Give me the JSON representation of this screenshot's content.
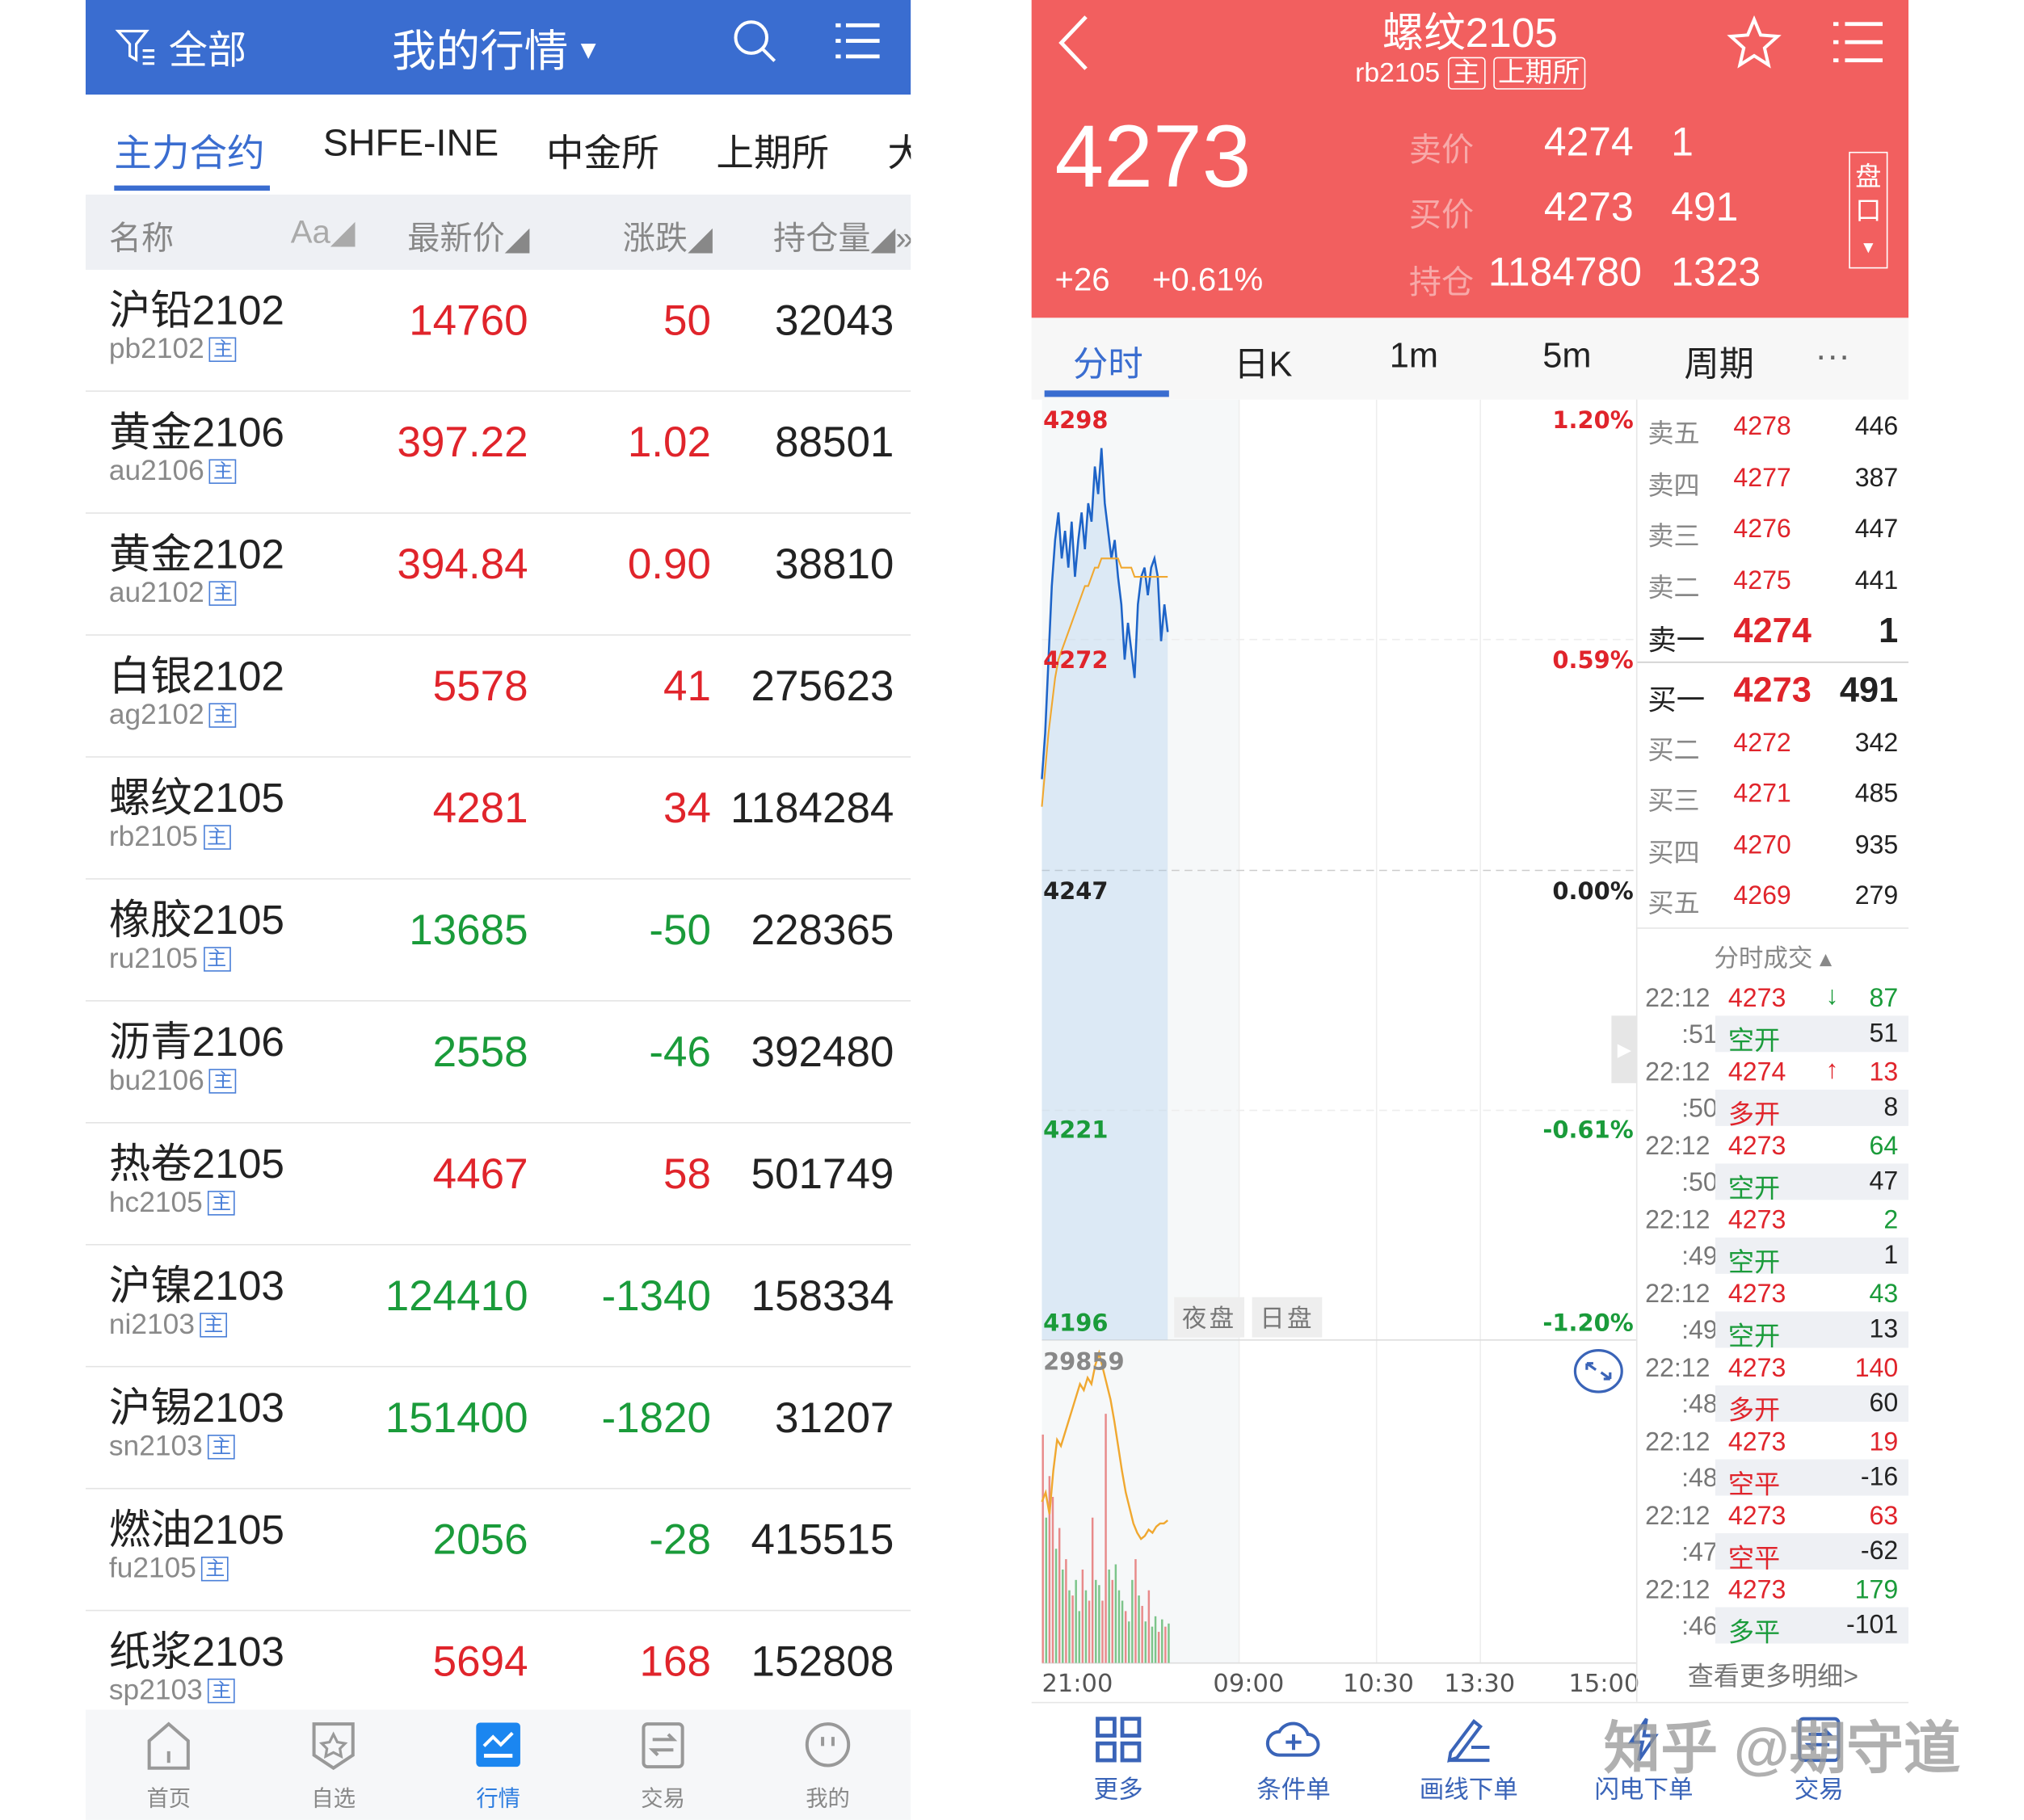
{
  "left": {
    "header": {
      "filter_label": "全部",
      "title": "我的行情",
      "icons": [
        "filter-icon",
        "search-icon",
        "menu-icon"
      ]
    },
    "tabs": [
      {
        "label": "主力合约",
        "active": true
      },
      {
        "label": "SHFE-INE"
      },
      {
        "label": "中金所"
      },
      {
        "label": "上期所"
      },
      {
        "label": "大"
      }
    ],
    "columns": {
      "name": "名称",
      "sort_font": "Aa◢",
      "price": "最新价◢",
      "change": "涨跌◢",
      "oi": "持仓量◢»"
    },
    "main_badge": "主",
    "rows": [
      {
        "name": "沪铅2102",
        "code": "pb2102",
        "price": "14760",
        "change": "50",
        "oi": "32043",
        "dir": "up"
      },
      {
        "name": "黄金2106",
        "code": "au2106",
        "price": "397.22",
        "change": "1.02",
        "oi": "88501",
        "dir": "up"
      },
      {
        "name": "黄金2102",
        "code": "au2102",
        "price": "394.84",
        "change": "0.90",
        "oi": "38810",
        "dir": "up"
      },
      {
        "name": "白银2102",
        "code": "ag2102",
        "price": "5578",
        "change": "41",
        "oi": "275623",
        "dir": "up"
      },
      {
        "name": "螺纹2105",
        "code": "rb2105",
        "price": "4281",
        "change": "34",
        "oi": "1184284",
        "dir": "up"
      },
      {
        "name": "橡胶2105",
        "code": "ru2105",
        "price": "13685",
        "change": "-50",
        "oi": "228365",
        "dir": "down"
      },
      {
        "name": "沥青2106",
        "code": "bu2106",
        "price": "2558",
        "change": "-46",
        "oi": "392480",
        "dir": "down"
      },
      {
        "name": "热卷2105",
        "code": "hc2105",
        "price": "4467",
        "change": "58",
        "oi": "501749",
        "dir": "up"
      },
      {
        "name": "沪镍2103",
        "code": "ni2103",
        "price": "124410",
        "change": "-1340",
        "oi": "158334",
        "dir": "down"
      },
      {
        "name": "沪锡2103",
        "code": "sn2103",
        "price": "151400",
        "change": "-1820",
        "oi": "31207",
        "dir": "down"
      },
      {
        "name": "燃油2105",
        "code": "fu2105",
        "price": "2056",
        "change": "-28",
        "oi": "415515",
        "dir": "down"
      },
      {
        "name": "纸浆2103",
        "code": "sp2103",
        "price": "5694",
        "change": "168",
        "oi": "152808",
        "dir": "up"
      }
    ],
    "nav": [
      {
        "label": "首页",
        "icon": "home-icon"
      },
      {
        "label": "自选",
        "icon": "favorites-icon"
      },
      {
        "label": "行情",
        "icon": "market-icon",
        "active": true
      },
      {
        "label": "交易",
        "icon": "trade-icon"
      },
      {
        "label": "我的",
        "icon": "profile-icon"
      }
    ]
  },
  "right": {
    "header": {
      "title": "螺纹2105",
      "code": "rb2105",
      "main_badge": "主",
      "exchange": "上期所",
      "last": "4273",
      "change": "+26",
      "change_pct": "+0.61%",
      "ask_label": "卖价",
      "ask": "4274",
      "ask_vol": "1",
      "bid_label": "买价",
      "bid": "4273",
      "bid_vol": "491",
      "oi_label": "持仓",
      "oi": "1184780",
      "oi_change": "1323",
      "panel_toggle": "盘口"
    },
    "tabs": [
      {
        "label": "分时",
        "active": true
      },
      {
        "label": "日K"
      },
      {
        "label": "1m"
      },
      {
        "label": "5m"
      },
      {
        "label": "周期"
      },
      {
        "label": "···"
      }
    ],
    "chart": {
      "y_labels": [
        {
          "price": "4298",
          "pct": "1.20%"
        },
        {
          "price": "4272",
          "pct": "0.59%"
        },
        {
          "price": "4247",
          "pct": "0.00%"
        },
        {
          "price": "4221",
          "pct": "-0.61%"
        },
        {
          "price": "4196",
          "pct": "-1.20%"
        }
      ],
      "ylim": [
        4196,
        4298
      ],
      "session_labels": [
        "夜盘",
        "日盘"
      ],
      "x_labels": [
        "21:00",
        "09:00",
        "10:30",
        "13:30",
        "15:00"
      ],
      "volume_max": "29859",
      "price": [
        4257,
        4262,
        4270,
        4278,
        4283,
        4286,
        4281,
        4284,
        4280,
        4285,
        4279,
        4283,
        4286,
        4282,
        4287,
        4285,
        4291,
        4288,
        4293,
        4287,
        4284,
        4281,
        4283,
        4279,
        4276,
        4270,
        4274,
        4271,
        4268,
        4276,
        4279,
        4280,
        4277,
        4280,
        4281,
        4279,
        4272,
        4276,
        4273
      ],
      "average": [
        4254,
        4258,
        4262,
        4265,
        4268,
        4270,
        4271,
        4272,
        4273,
        4274,
        4275,
        4276,
        4277,
        4278,
        4278,
        4279,
        4280,
        4280,
        4281,
        4281,
        4281,
        4281,
        4281,
        4281,
        4280,
        4280,
        4280,
        4280,
        4279,
        4279,
        4279,
        4279,
        4279,
        4279,
        4279,
        4279,
        4279,
        4279,
        4279
      ],
      "volume": [
        22000,
        14000,
        18000,
        16000,
        11000,
        13000,
        9000,
        10000,
        7000,
        6500,
        8000,
        5000,
        9000,
        7000,
        6000,
        14000,
        8000,
        7500,
        6000,
        24000,
        9000,
        8000,
        9500,
        7000,
        6000,
        5000,
        4000,
        8000,
        10000,
        6500,
        5500,
        4000,
        7000,
        3500,
        4500,
        3000,
        4200,
        3500,
        3800
      ],
      "volume_dir": [
        "up",
        "down",
        "up",
        "up",
        "down",
        "up",
        "down",
        "up",
        "down",
        "up",
        "down",
        "down",
        "up",
        "down",
        "up",
        "up",
        "down",
        "down",
        "up",
        "up",
        "down",
        "up",
        "down",
        "down",
        "down",
        "up",
        "down",
        "down",
        "up",
        "down",
        "up",
        "down",
        "up",
        "down",
        "down",
        "up",
        "down",
        "up",
        "down"
      ],
      "oi_line": [
        0.52,
        0.55,
        0.48,
        0.62,
        0.72,
        0.7,
        0.74,
        0.78,
        0.82,
        0.86,
        0.9,
        0.88,
        0.92,
        0.9,
        0.96,
        1.0,
        0.95,
        0.9,
        0.85,
        0.78,
        0.7,
        0.62,
        0.55,
        0.5,
        0.45,
        0.42,
        0.4,
        0.41,
        0.43,
        0.42,
        0.44,
        0.45,
        0.45,
        0.46
      ]
    },
    "orderbook": [
      {
        "label": "卖五",
        "price": "4278",
        "vol": "446"
      },
      {
        "label": "卖四",
        "price": "4277",
        "vol": "387"
      },
      {
        "label": "卖三",
        "price": "4276",
        "vol": "447"
      },
      {
        "label": "卖二",
        "price": "4275",
        "vol": "441"
      },
      {
        "label": "卖一",
        "price": "4274",
        "vol": "1",
        "bold": true
      },
      {
        "label": "买一",
        "price": "4273",
        "vol": "491",
        "bold": true
      },
      {
        "label": "买二",
        "price": "4272",
        "vol": "342"
      },
      {
        "label": "买三",
        "price": "4271",
        "vol": "485"
      },
      {
        "label": "买四",
        "price": "4270",
        "vol": "935"
      },
      {
        "label": "买五",
        "price": "4269",
        "vol": "279"
      }
    ],
    "trades_title": "分时成交 ▴",
    "trades": [
      {
        "time": "22:12",
        "sec": ":51",
        "price": "4273",
        "arrow": "↓",
        "vol": "87",
        "vcolor": "green",
        "type": "空开",
        "tcolor": "green",
        "oi": "51"
      },
      {
        "time": "22:12",
        "sec": ":50",
        "price": "4274",
        "arrow": "↑",
        "vol": "13",
        "vcolor": "red",
        "type": "多开",
        "tcolor": "red",
        "oi": "8"
      },
      {
        "time": "22:12",
        "sec": ":50",
        "price": "4273",
        "arrow": "",
        "vol": "64",
        "vcolor": "green",
        "type": "空开",
        "tcolor": "green",
        "oi": "47"
      },
      {
        "time": "22:12",
        "sec": ":49",
        "price": "4273",
        "arrow": "",
        "vol": "2",
        "vcolor": "green",
        "type": "空开",
        "tcolor": "green",
        "oi": "1"
      },
      {
        "time": "22:12",
        "sec": ":49",
        "price": "4273",
        "arrow": "",
        "vol": "43",
        "vcolor": "green",
        "type": "空开",
        "tcolor": "green",
        "oi": "13"
      },
      {
        "time": "22:12",
        "sec": ":48",
        "price": "4273",
        "arrow": "",
        "vol": "140",
        "vcolor": "red",
        "type": "多开",
        "tcolor": "red",
        "oi": "60"
      },
      {
        "time": "22:12",
        "sec": ":48",
        "price": "4273",
        "arrow": "",
        "vol": "19",
        "vcolor": "red",
        "type": "空平",
        "tcolor": "red",
        "oi": "-16"
      },
      {
        "time": "22:12",
        "sec": ":47",
        "price": "4273",
        "arrow": "",
        "vol": "63",
        "vcolor": "red",
        "type": "空平",
        "tcolor": "red",
        "oi": "-62"
      },
      {
        "time": "22:12",
        "sec": ":46",
        "price": "4273",
        "arrow": "",
        "vol": "179",
        "vcolor": "green",
        "type": "多平",
        "tcolor": "green",
        "oi": "-101"
      }
    ],
    "more_details": "查看更多明细>",
    "toolbar": [
      {
        "label": "更多",
        "icon": "grid-icon"
      },
      {
        "label": "条件单",
        "icon": "cloud-plus-icon"
      },
      {
        "label": "画线下单",
        "icon": "pen-icon"
      },
      {
        "label": "闪电下单",
        "icon": "lightning-icon"
      },
      {
        "label": "交易",
        "icon": "trade-icon"
      }
    ]
  },
  "watermark": "知乎 @期守道",
  "colors": {
    "header_blue": "#3a6dd0",
    "header_red": "#f25f5f",
    "up": "#e0242b",
    "down": "#1a9b3a",
    "accent": "#3a6dd0"
  }
}
